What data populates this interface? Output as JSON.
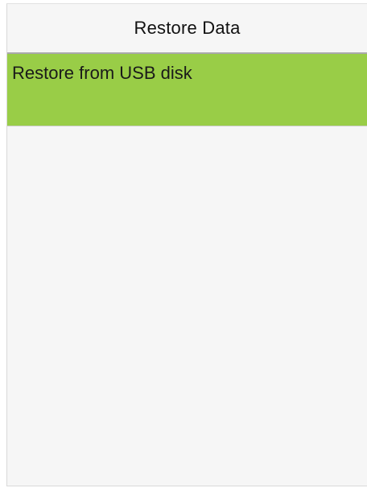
{
  "header": {
    "title": "Restore Data"
  },
  "menu": {
    "items": [
      {
        "label": "Restore from USB disk",
        "selected": true
      }
    ]
  },
  "colors": {
    "selected_background": "#99cd47",
    "screen_background": "#f6f6f6"
  }
}
